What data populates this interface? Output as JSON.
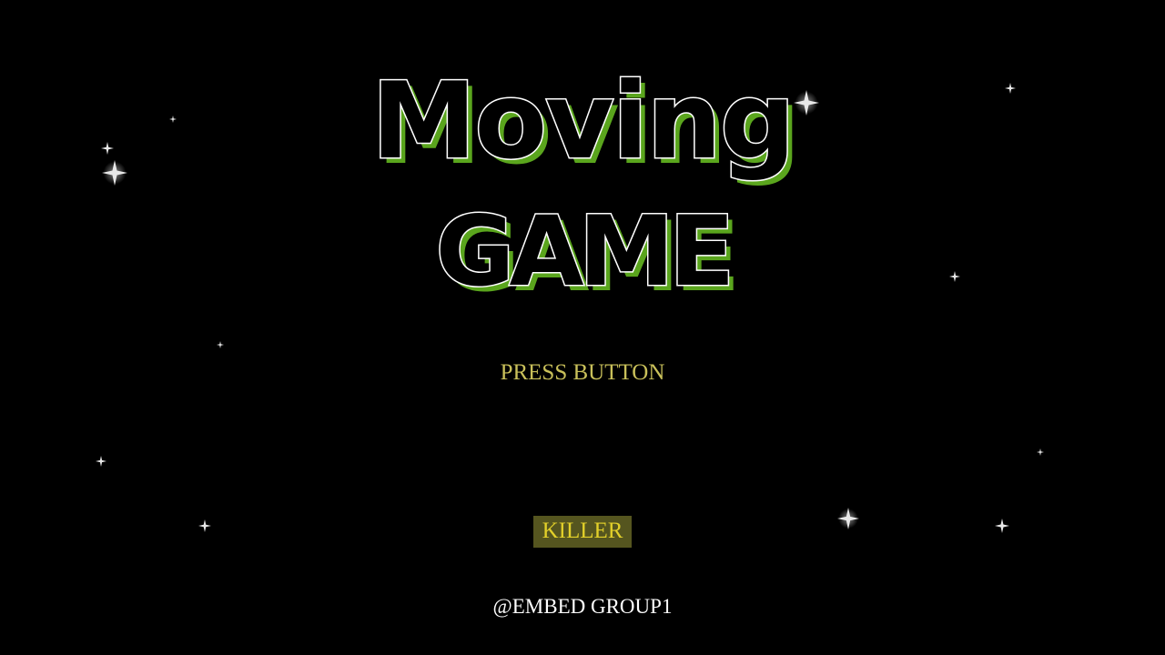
{
  "title": {
    "line1": "Moving",
    "line2": "GAME"
  },
  "prompt": "PRESS BUTTON",
  "menu": {
    "selected_option": "KILLER"
  },
  "credits": "@EMBED GROUP1",
  "colors": {
    "background": "#000000",
    "title_outline": "#ffffff",
    "title_shadow": "#5aa51d",
    "prompt_text": "#c9c05a",
    "menu_highlight_bg": "#55551f",
    "menu_text": "#e2d02a",
    "credits_text": "#ffffff"
  },
  "decorations": {
    "star_icon": "four-point-sparkle"
  }
}
